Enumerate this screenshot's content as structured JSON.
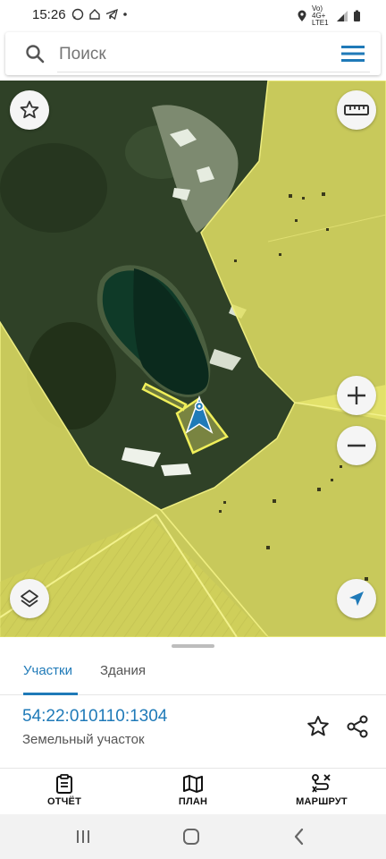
{
  "status": {
    "time": "15:26",
    "network_label": "Vo) 4G+ LTE1"
  },
  "search": {
    "placeholder": "Поиск"
  },
  "panel": {
    "tabs": [
      {
        "label": "Участки",
        "active": true
      },
      {
        "label": "Здания",
        "active": false
      }
    ],
    "parcel": {
      "cadastral_number": "54:22:010110:1304",
      "type": "Земельный участок"
    }
  },
  "bottom_nav": {
    "report_label": "ОТЧЁТ",
    "plan_label": "ПЛАН",
    "route_label": "МАРШРУТ"
  },
  "colors": {
    "accent": "#1f7ab8",
    "parcel_overlay": "#e9e86a",
    "selected_marker": "#1f7ab8"
  }
}
